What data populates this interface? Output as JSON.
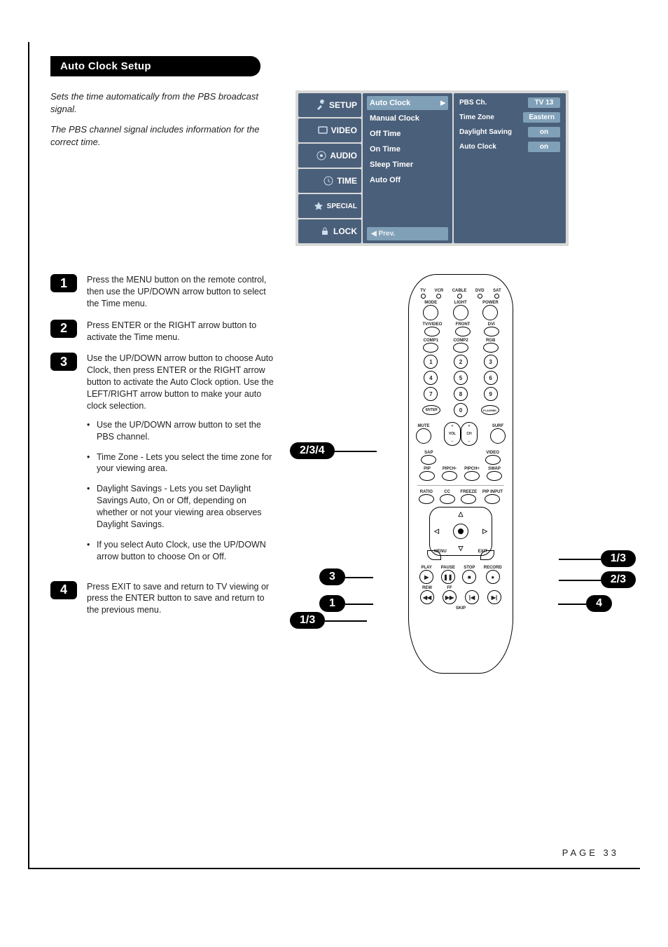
{
  "header": {
    "title": "Auto Clock Setup"
  },
  "intro": {
    "p1": "Sets the time automatically from the PBS broadcast signal.",
    "p2": "The PBS channel signal includes information for the correct time."
  },
  "osd": {
    "tabs": [
      "SETUP",
      "VIDEO",
      "AUDIO",
      "TIME",
      "SPECIAL",
      "LOCK"
    ],
    "menu": {
      "items": [
        "Auto Clock",
        "Manual Clock",
        "Off Time",
        "On Time",
        "Sleep Timer",
        "Auto Off"
      ],
      "selected_index": 0,
      "prev": "◀ Prev."
    },
    "panel": {
      "rows": [
        {
          "label": "PBS Ch.",
          "value": "TV 13"
        },
        {
          "label": "Time Zone",
          "value": "Eastern"
        },
        {
          "label": "Daylight Saving",
          "value": "on"
        },
        {
          "label": "Auto Clock",
          "value": "on"
        }
      ]
    }
  },
  "steps": [
    {
      "n": "1",
      "text": "Press the MENU button on the remote control, then use the UP/DOWN arrow button to select the Time menu."
    },
    {
      "n": "2",
      "text": "Press ENTER or the RIGHT arrow button to activate the Time menu."
    },
    {
      "n": "3",
      "text": "Use the UP/DOWN arrow button to choose Auto Clock, then press ENTER or the RIGHT arrow button to activate the Auto Clock option. Use the LEFT/RIGHT arrow button to make your auto clock selection.",
      "bullets": [
        "Use the UP/DOWN arrow button to set the PBS channel.",
        "Time Zone - Lets you select the time zone for your viewing area.",
        "Daylight Savings - Lets you set Daylight Savings Auto, On or Off, depending on whether or not your viewing area observes Daylight Savings.",
        "If you select Auto Clock, use the UP/DOWN arrow button to choose On or Off."
      ]
    },
    {
      "n": "4",
      "text": "Press EXIT to save and return to TV viewing or press the ENTER button to save and return to the previous menu."
    }
  ],
  "remote": {
    "top_labels": [
      "TV",
      "VCR",
      "CABLE",
      "DVD",
      "SAT"
    ],
    "row2": [
      "MODE",
      "LIGHT",
      "POWER"
    ],
    "row3": [
      "TV/VIDEO",
      "FRONT",
      "DVI"
    ],
    "row4": [
      "COMP1",
      "COMP2",
      "RGB"
    ],
    "numpad": [
      "1",
      "2",
      "3",
      "4",
      "5",
      "6",
      "7",
      "8",
      "9",
      "0"
    ],
    "enter": "ENTER",
    "flashbk": "FLASHBK",
    "mute": "MUTE",
    "surf": "SURF",
    "sap": "SAP",
    "vol": "VOL",
    "ch": "CH",
    "video_lbl": "VIDEO",
    "pip_row": [
      "PIP",
      "PIPCH-",
      "PIPCH+",
      "SWAP"
    ],
    "mid_row": [
      "RATIO",
      "CC",
      "FREEZE",
      "PIP INPUT"
    ],
    "menu": "MENU",
    "exit": "EXIT",
    "transport1": [
      "PLAY",
      "PAUSE",
      "STOP",
      "RECORD"
    ],
    "transport2": [
      "REW",
      "FF",
      "SKIP"
    ]
  },
  "callouts": {
    "enter": "2/3/4",
    "dpad_left": "3",
    "dpad_menu": "1",
    "dpad_bottom_left": "1/3",
    "dpad_up_right": "1/3",
    "dpad_right": "2/3",
    "exit_right": "4"
  },
  "page_num": "PAGE 33"
}
